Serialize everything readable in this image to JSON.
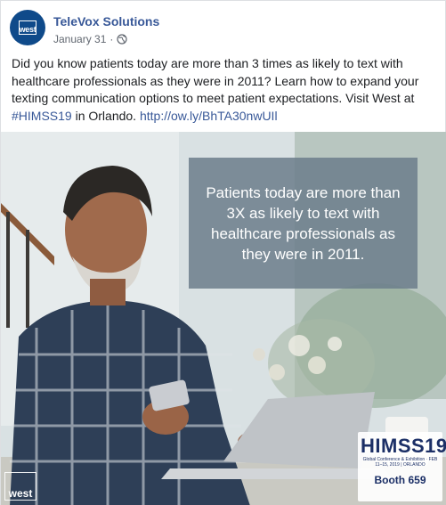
{
  "post": {
    "page_name": "TeleVox Solutions",
    "avatar_text": "west",
    "date": "January 31",
    "separator": "·",
    "audience_icon": "globe-icon",
    "text_before": "Did you know patients today are more than 3 times as likely to text with healthcare professionals as they were in 2011? Learn how to expand your texting communication options to meet patient expectations. Visit West at ",
    "hashtag": "#HIMSS19",
    "text_middle": " in Orlando. ",
    "link": "http://ow.ly/BhTA30nwUIl"
  },
  "image": {
    "quote": "Patients today are more than 3X as likely to text with healthcare professionals as they were in 2011.",
    "corner_logo_text": "west",
    "himss_logo": "HIMSS19",
    "himss_subtitle": "Global Conference & Exhibition · FEB 11–15, 2019 | ORLANDO",
    "booth": "Booth 659"
  },
  "colors": {
    "brand_blue": "#0f4a8a",
    "link_blue": "#385898",
    "quote_box": "#6c7e8c"
  }
}
